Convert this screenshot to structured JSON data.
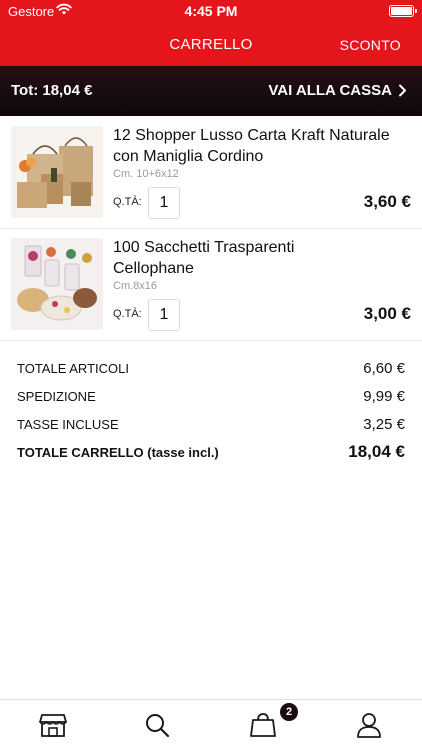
{
  "status_bar": {
    "carrier": "Gestore",
    "time": "4:45 PM"
  },
  "header": {
    "title": "CARRELLO",
    "discount_label": "SCONTO"
  },
  "total_bar": {
    "total_label": "Tot: 18,04 €",
    "checkout_label": "VAI ALLA CASSA"
  },
  "items": [
    {
      "name": "12 Shopper Lusso Carta Kraft Naturale con Maniglia Cordino",
      "dimensions": "Cm. 10+6x12",
      "qty_label": "Q.TÀ:",
      "qty": "1",
      "price": "3,60 €"
    },
    {
      "name": "100 Sacchetti Trasparenti Cellophane",
      "dimensions": "Cm.8x16",
      "qty_label": "Q.TÀ:",
      "qty": "1",
      "price": "3,00 €"
    }
  ],
  "summary": {
    "articles_label": "TOTALE ARTICOLI",
    "articles_value": "6,60 €",
    "shipping_label": "SPEDIZIONE",
    "shipping_value": "9,99 €",
    "tax_label": "TASSE INCLUSE",
    "tax_value": "3,25 €",
    "total_label": "TOTALE CARRELLO (tasse incl.)",
    "total_value": "18,04 €"
  },
  "tabbar": {
    "tabs": [
      {
        "icon": "shop-icon"
      },
      {
        "icon": "search-icon"
      },
      {
        "icon": "shopping-bag-icon"
      },
      {
        "icon": "user-icon"
      }
    ],
    "cart_badge": "2"
  },
  "colors": {
    "brand_red": "#e4161b",
    "dark_bar": "#150a0b",
    "badge": "#1c0b0d"
  }
}
